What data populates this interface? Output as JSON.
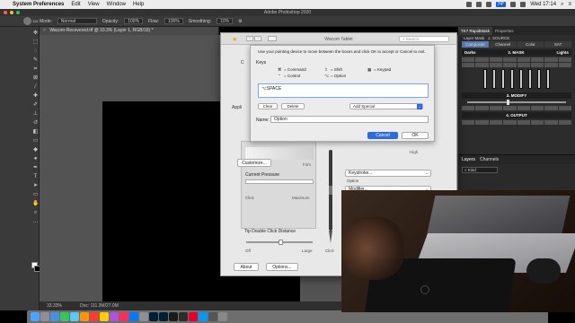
{
  "menubar": {
    "app_name": "System Preferences",
    "menus": [
      "Edit",
      "View",
      "Window",
      "Help"
    ],
    "clock": "Wed 17:14",
    "temp_badge": "74°"
  },
  "photoshop": {
    "title": "Adobe Photoshop 2020",
    "brush_size": "110",
    "options": {
      "mode_label": "Mode:",
      "mode_value": "Normal",
      "opacity_label": "Opacity:",
      "opacity_value": "100%",
      "flow_label": "Flow:",
      "flow_value": "100%",
      "smoothing_label": "Smoothing:",
      "smoothing_value": "10%"
    },
    "doc_tab": "Wacom-Recovered.tif @ 33.3% (Layer 1, RGB/16) *",
    "status_zoom": "33.33%",
    "status_doc": "Doc: 111.3M/27.0M",
    "panels": {
      "tabs": [
        "Layer Mask",
        "1. SOURCE"
      ],
      "rm_title": "TK7 RapidMask",
      "rm_props": "Properties",
      "rm_tabs": [
        "Composite",
        "Channel",
        "Color",
        "SAT"
      ],
      "section_mask": "2. MASK",
      "darks": "Darks",
      "lights": "Lights",
      "section_modify": "3. MODIFY",
      "section_output": "4. OUTPUT",
      "layers_tabs": [
        "Layers",
        "Channels"
      ],
      "layers_kind": "Kind"
    }
  },
  "wacom": {
    "title": "Wacom Tablet",
    "search_placeholder": "Search",
    "bg_label": "Appli",
    "frag_label": "C",
    "customize": "Customize...",
    "current_pressure": "Current Pressure",
    "soft": "Soft",
    "firm": "Firm",
    "click": "Click",
    "maximum": "Maximum",
    "tip_double_click": "Tip Double Click Distance",
    "off": "Off",
    "large": "Large",
    "pen_click": "Click",
    "high": "High",
    "keystroke": "Keystroke...",
    "option": "Option",
    "modifier": "Modifier...",
    "about": "About",
    "options": "Options..."
  },
  "keystroke_sheet": {
    "instructions": "Use your pointing device to move between the boxes and click OK to accept or Cancel to exit.",
    "keys_label": "Keys",
    "legend": {
      "command": "= Command",
      "shift": "= Shift",
      "keypad": "= Keypad",
      "control": "= Control",
      "option": "= Option"
    },
    "keys_value": "⌥SPACE",
    "clear": "Clear",
    "delete": "Delete",
    "add_special": "Add Special",
    "name_label": "Name:",
    "name_value": "Option",
    "cancel": "Cancel",
    "ok": "OK"
  },
  "colors": {
    "accent": "#2d6be0",
    "ps_dark": "#3a3a3a"
  }
}
